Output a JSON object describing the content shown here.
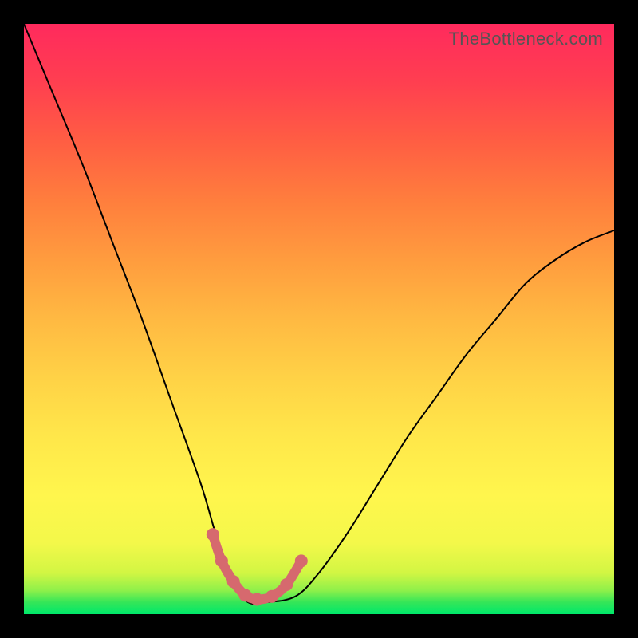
{
  "watermark": "TheBottleneck.com",
  "chart_data": {
    "type": "line",
    "title": "",
    "xlabel": "",
    "ylabel": "",
    "xlim": [
      0,
      1
    ],
    "ylim": [
      0,
      1
    ],
    "series": [
      {
        "name": "bottleneck-curve",
        "x": [
          0.0,
          0.05,
          0.1,
          0.15,
          0.2,
          0.25,
          0.3,
          0.33,
          0.36,
          0.38,
          0.41,
          0.46,
          0.5,
          0.55,
          0.6,
          0.65,
          0.7,
          0.75,
          0.8,
          0.85,
          0.9,
          0.95,
          1.0
        ],
        "values": [
          1.0,
          0.88,
          0.76,
          0.63,
          0.5,
          0.36,
          0.22,
          0.12,
          0.05,
          0.02,
          0.02,
          0.03,
          0.07,
          0.14,
          0.22,
          0.3,
          0.37,
          0.44,
          0.5,
          0.56,
          0.6,
          0.63,
          0.65
        ]
      },
      {
        "name": "highlight-segment",
        "x": [
          0.32,
          0.335,
          0.355,
          0.375,
          0.395,
          0.42,
          0.445,
          0.47
        ],
        "values": [
          0.135,
          0.09,
          0.055,
          0.032,
          0.025,
          0.03,
          0.05,
          0.09
        ]
      }
    ],
    "colors": {
      "curve": "#000000",
      "highlight": "#d6696e"
    }
  }
}
